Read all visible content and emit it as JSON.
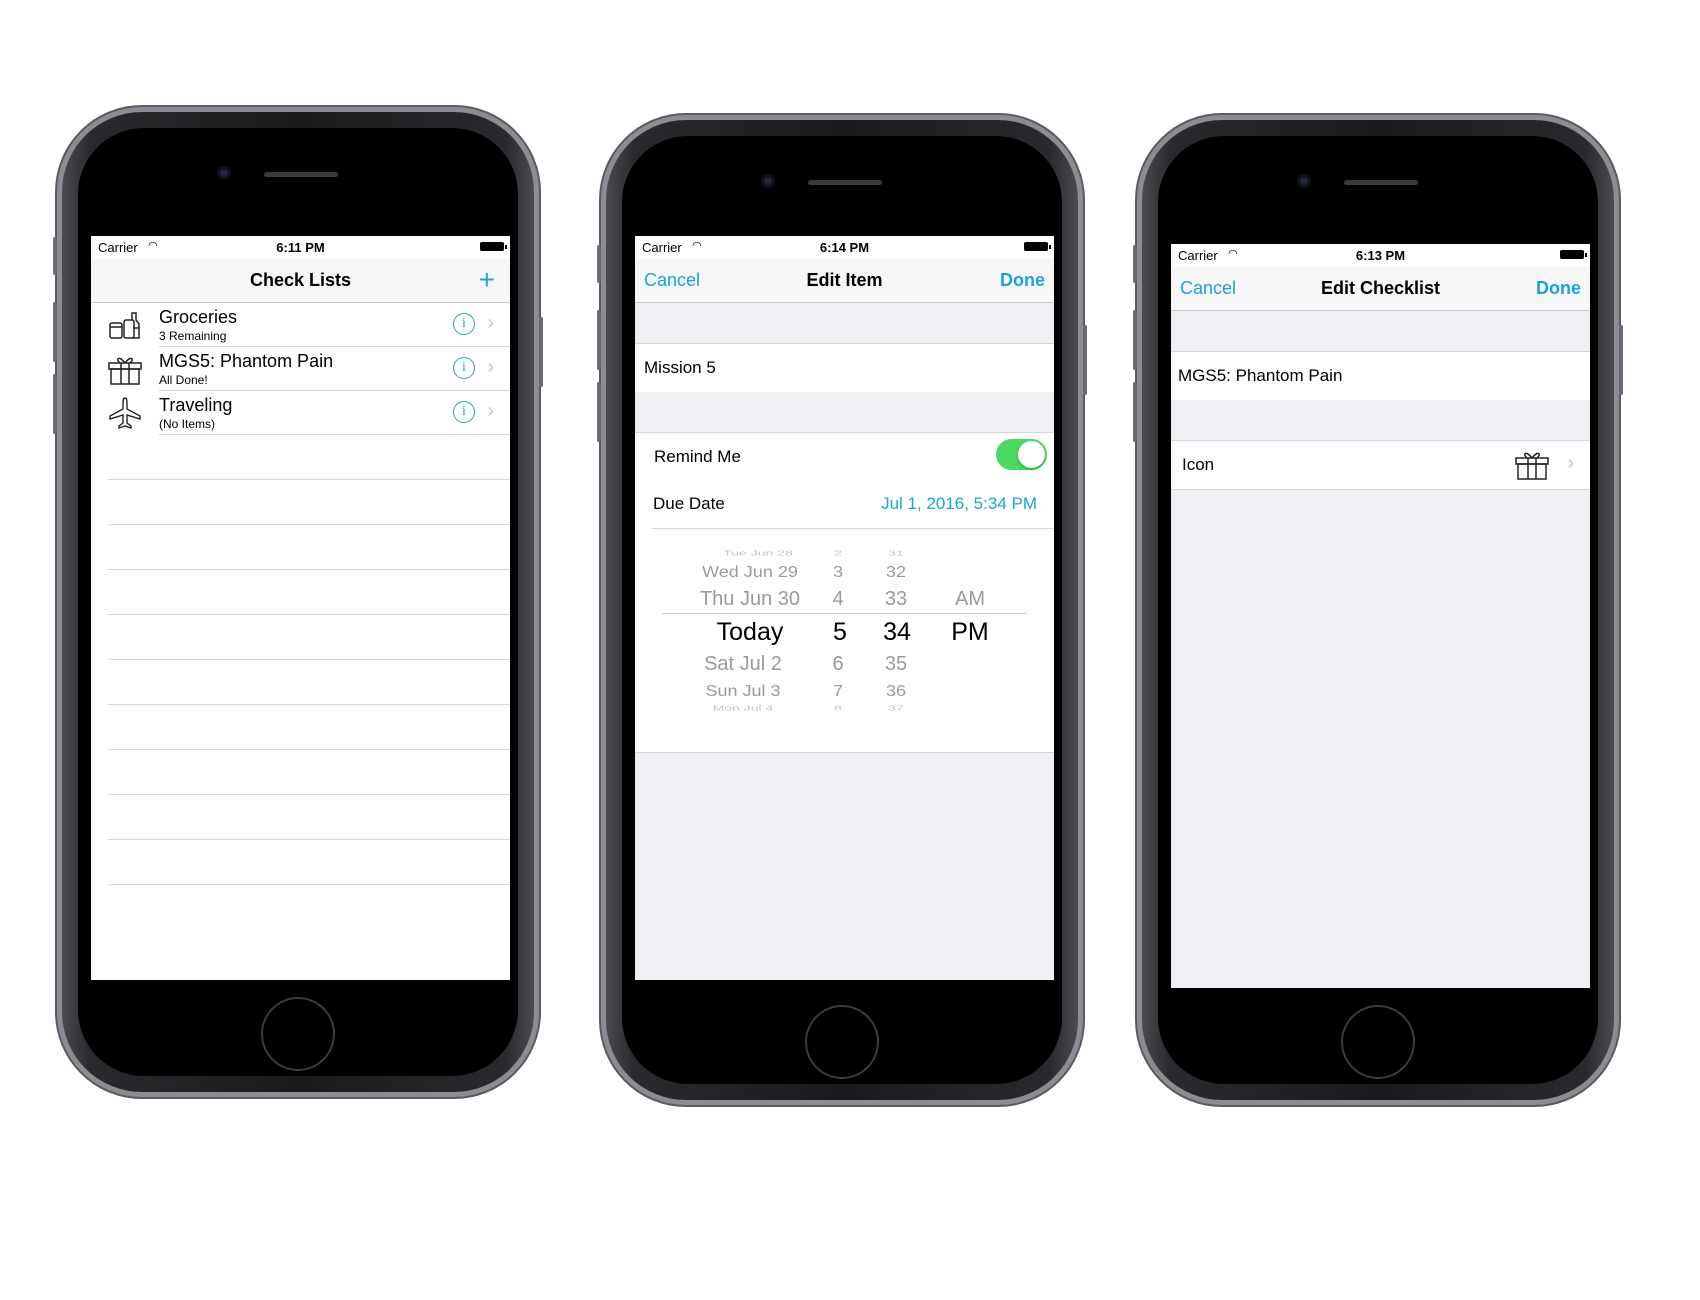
{
  "phone1": {
    "status": {
      "carrier": "Carrier",
      "time": "6:11 PM"
    },
    "nav": {
      "title": "Check Lists",
      "add_label": "+"
    },
    "rows": [
      {
        "name": "Groceries",
        "sub": "3 Remaining",
        "icon": "groceries-icon"
      },
      {
        "name": "MGS5: Phantom Pain",
        "sub": "All Done!",
        "icon": "gift-icon"
      },
      {
        "name": "Traveling",
        "sub": "(No Items)",
        "icon": "airplane-icon"
      }
    ],
    "info_glyph": "i",
    "chevron_glyph": "›"
  },
  "phone2": {
    "status": {
      "carrier": "Carrier",
      "time": "6:14 PM"
    },
    "nav": {
      "left": "Cancel",
      "title": "Edit Item",
      "right": "Done"
    },
    "item_name": "Mission 5",
    "remind_label": "Remind Me",
    "remind_on": true,
    "due_label": "Due Date",
    "due_value": "Jul 1, 2016, 5:34 PM",
    "picker": {
      "dates": [
        "Tue Jun 28",
        "Wed Jun 29",
        "Thu Jun 30",
        "Today",
        "Sat Jul 2",
        "Sun Jul 3",
        "Mon Jul 4"
      ],
      "hours": [
        "2",
        "3",
        "4",
        "5",
        "6",
        "7",
        "8"
      ],
      "minutes": [
        "31",
        "32",
        "33",
        "34",
        "35",
        "36",
        "37"
      ],
      "ampm": [
        "AM",
        "PM"
      ]
    }
  },
  "phone3": {
    "status": {
      "carrier": "Carrier",
      "time": "6:13 PM"
    },
    "nav": {
      "left": "Cancel",
      "title": "Edit Checklist",
      "right": "Done"
    },
    "name_value": "MGS5: Phantom Pain",
    "icon_label": "Icon",
    "chevron_glyph": "›"
  },
  "colors": {
    "accent": "#1aa3dd",
    "toggle_on": "#4cd964",
    "grouped_bg": "#efeff4"
  }
}
